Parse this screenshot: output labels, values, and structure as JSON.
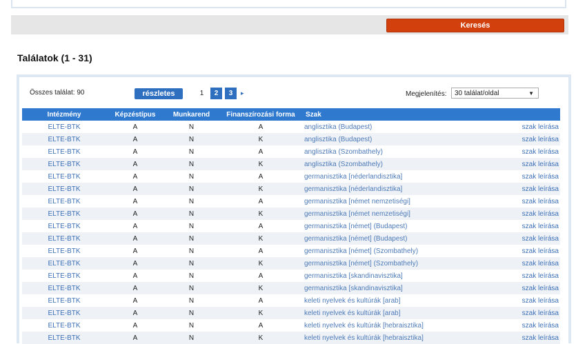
{
  "search": {
    "button_label": "Keresés"
  },
  "results": {
    "title": "Találatok (1 - 31)",
    "total": "Összes találat: 90",
    "details_label": "részletes",
    "pages": [
      "1",
      "2",
      "3"
    ],
    "active_page": "2",
    "next_icon": "▸",
    "display_label": "Megjelenítés:",
    "display_value": "30 találat/oldal",
    "columns": [
      "Intézmény",
      "Képzéstípus",
      "Munkarend",
      "Finanszírozási forma",
      "Szak",
      ""
    ],
    "rows": [
      [
        "ELTE-BTK",
        "A",
        "N",
        "A",
        "anglisztika (Budapest)",
        "szak leírása"
      ],
      [
        "ELTE-BTK",
        "A",
        "N",
        "K",
        "anglisztika (Budapest)",
        "szak leírása"
      ],
      [
        "ELTE-BTK",
        "A",
        "N",
        "A",
        "anglisztika (Szombathely)",
        "szak leírása"
      ],
      [
        "ELTE-BTK",
        "A",
        "N",
        "K",
        "anglisztika (Szombathely)",
        "szak leírása"
      ],
      [
        "ELTE-BTK",
        "A",
        "N",
        "A",
        "germanisztika [néderlandisztika]",
        "szak leírása"
      ],
      [
        "ELTE-BTK",
        "A",
        "N",
        "K",
        "germanisztika [néderlandisztika]",
        "szak leírása"
      ],
      [
        "ELTE-BTK",
        "A",
        "N",
        "A",
        "germanisztika [német nemzetiségi]",
        "szak leírása"
      ],
      [
        "ELTE-BTK",
        "A",
        "N",
        "K",
        "germanisztika [német nemzetiségi]",
        "szak leírása"
      ],
      [
        "ELTE-BTK",
        "A",
        "N",
        "A",
        "germanisztika [német] (Budapest)",
        "szak leírása"
      ],
      [
        "ELTE-BTK",
        "A",
        "N",
        "K",
        "germanisztika [német] (Budapest)",
        "szak leírása"
      ],
      [
        "ELTE-BTK",
        "A",
        "N",
        "A",
        "germanisztika [német] (Szombathely)",
        "szak leírása"
      ],
      [
        "ELTE-BTK",
        "A",
        "N",
        "K",
        "germanisztika [német] (Szombathely)",
        "szak leírása"
      ],
      [
        "ELTE-BTK",
        "A",
        "N",
        "A",
        "germanisztika [skandinavisztika]",
        "szak leírása"
      ],
      [
        "ELTE-BTK",
        "A",
        "N",
        "K",
        "germanisztika [skandinavisztika]",
        "szak leírása"
      ],
      [
        "ELTE-BTK",
        "A",
        "N",
        "A",
        "keleti nyelvek és kultúrák [arab]",
        "szak leírása"
      ],
      [
        "ELTE-BTK",
        "A",
        "N",
        "K",
        "keleti nyelvek és kultúrák [arab]",
        "szak leírása"
      ],
      [
        "ELTE-BTK",
        "A",
        "N",
        "A",
        "keleti nyelvek és kultúrák [hebraisztika]",
        "szak leírása"
      ],
      [
        "ELTE-BTK",
        "A",
        "N",
        "K",
        "keleti nyelvek és kultúrák [hebraisztika]",
        "szak leírása"
      ]
    ]
  },
  "colors": {
    "search_button": "#d2400e",
    "header": "#2f79cf",
    "link": "#3b6fb5",
    "accent": "#2e6fc0"
  }
}
